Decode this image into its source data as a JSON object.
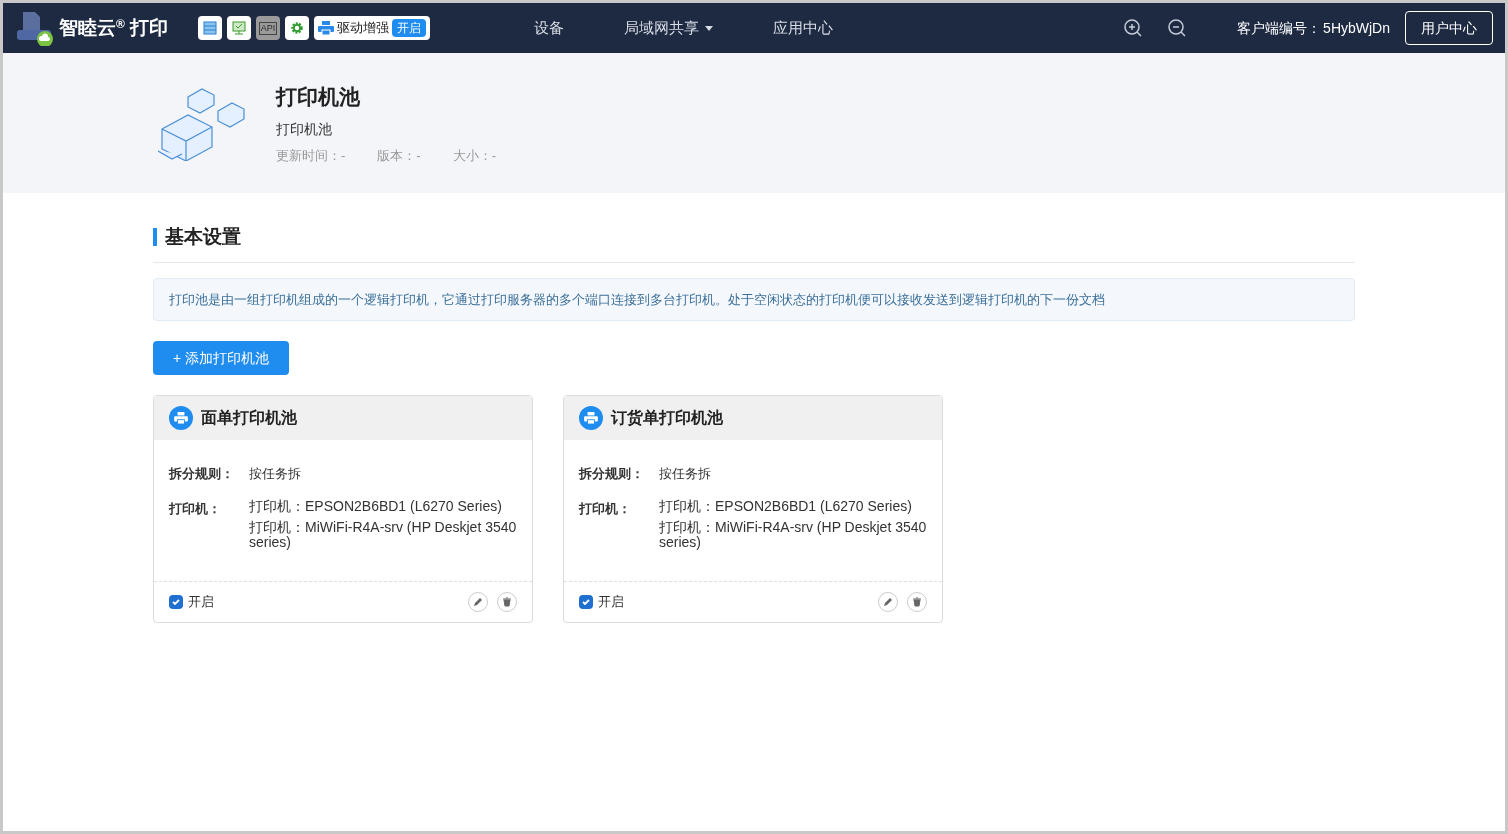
{
  "header": {
    "brand": "智睦云",
    "brand_mark": "®",
    "brand_suffix": "打印",
    "toolbar": [
      {
        "kind": "server",
        "disabled": false
      },
      {
        "kind": "monitor",
        "disabled": false
      },
      {
        "kind": "api",
        "label": "API",
        "disabled": true
      },
      {
        "kind": "gear",
        "disabled": false
      }
    ],
    "driver_boost": {
      "label": "驱动增强",
      "state": "开启",
      "on": true
    },
    "nav": [
      {
        "label": "设备",
        "dropdown": false
      },
      {
        "label": "局域网共享",
        "dropdown": true
      },
      {
        "label": "应用中心",
        "dropdown": false
      }
    ],
    "client_id_label": "客户端编号：",
    "client_id": "5HybWjDn",
    "user_center": "用户中心"
  },
  "app": {
    "title": "打印机池",
    "subtitle": "打印机池",
    "meta": [
      {
        "label": "更新时间：",
        "value": "-"
      },
      {
        "label": "版本：",
        "value": "-"
      },
      {
        "label": "大小：",
        "value": "-"
      }
    ]
  },
  "section": {
    "title": "基本设置",
    "notice": "打印池是由一组打印机组成的一个逻辑打印机，它通过打印服务器的多个端口连接到多台打印机。处于空闲状态的打印机便可以接收发送到逻辑打印机的下一份文档",
    "add_button": "+ 添加打印机池"
  },
  "pools": [
    {
      "title": "面单打印机池",
      "rule_label": "拆分规则：",
      "rule": "按任务拆",
      "printer_label": "打印机：",
      "printers": [
        "打印机：EPSON2B6BD1 (L6270 Series)",
        "打印机：MiWiFi-R4A-srv (HP Deskjet 3540 series)"
      ],
      "enabled_label": "开启",
      "enabled": true
    },
    {
      "title": "订货单打印机池",
      "rule_label": "拆分规则：",
      "rule": "按任务拆",
      "printer_label": "打印机：",
      "printers": [
        "打印机：EPSON2B6BD1 (L6270 Series)",
        "打印机：MiWiFi-R4A-srv (HP Deskjet 3540 series)"
      ],
      "enabled_label": "开启",
      "enabled": true
    }
  ]
}
